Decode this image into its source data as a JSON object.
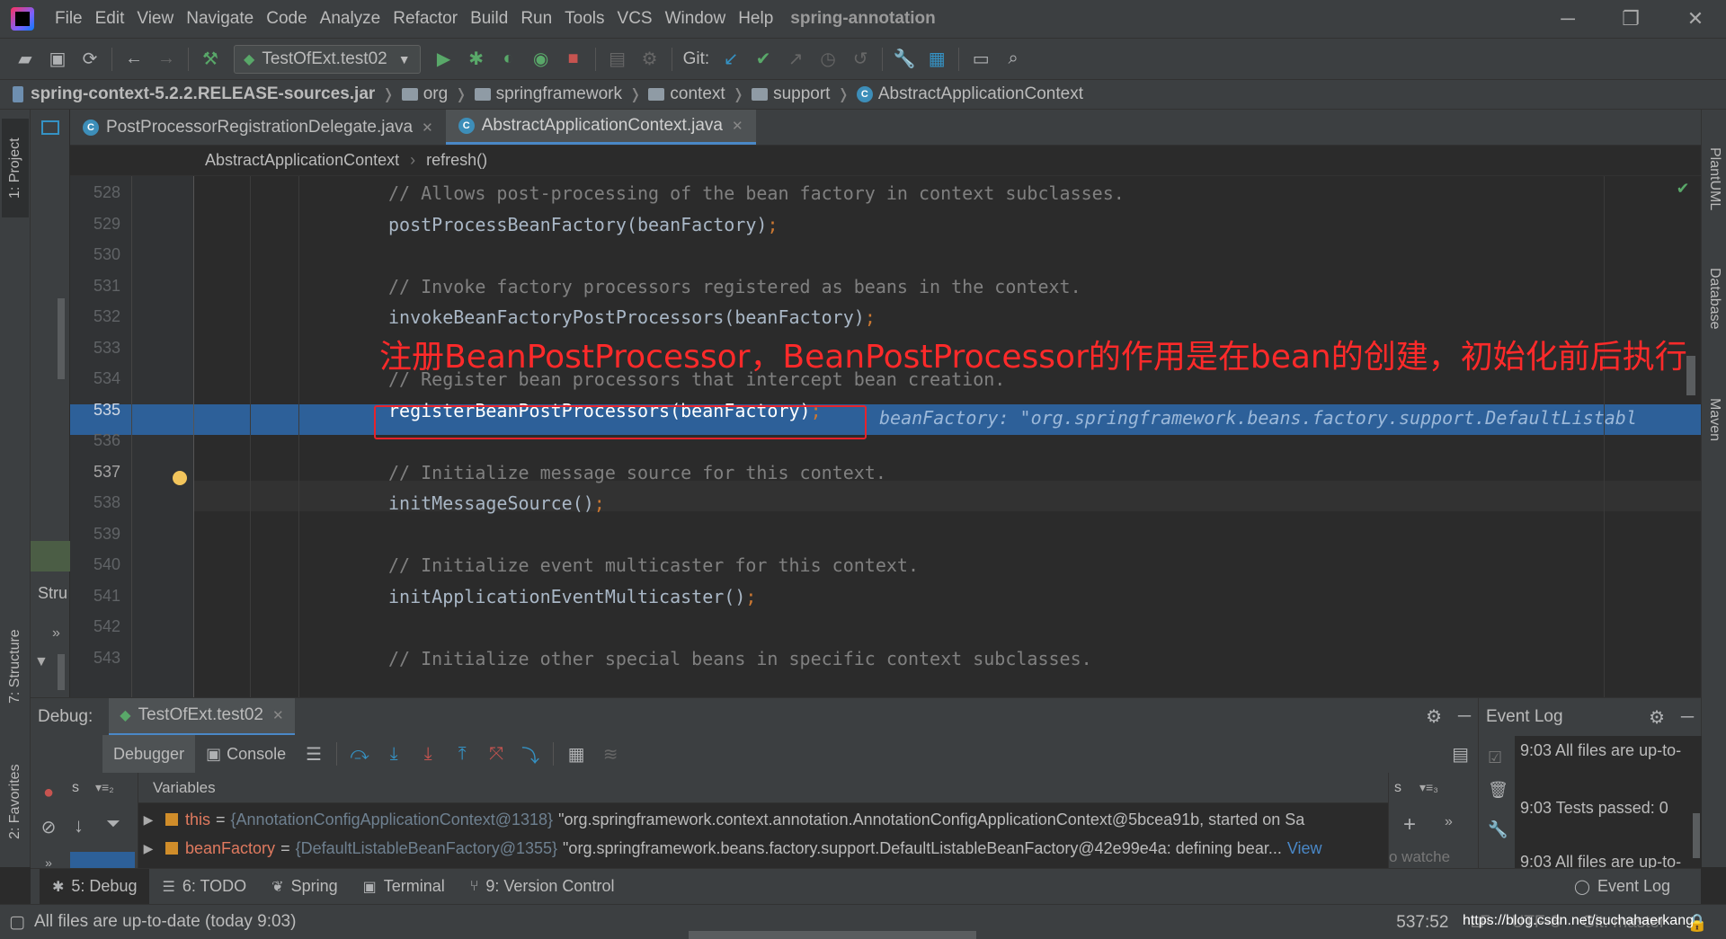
{
  "menubar": {
    "items": [
      "File",
      "Edit",
      "View",
      "Navigate",
      "Code",
      "Analyze",
      "Refactor",
      "Build",
      "Run",
      "Tools",
      "VCS",
      "Window",
      "Help"
    ],
    "project_title": "spring-annotation",
    "minimize": "─",
    "restore": "❐",
    "close": "✕"
  },
  "toolbar": {
    "run_config": "TestOfExt.test02",
    "git_label": "Git:"
  },
  "navbar": {
    "jar": "spring-context-5.2.2.RELEASE-sources.jar",
    "crumbs": [
      "org",
      "springframework",
      "context",
      "support"
    ],
    "class_name": "AbstractApplicationContext"
  },
  "editor": {
    "tabs": [
      {
        "label": "PostProcessorRegistrationDelegate.java",
        "active": false
      },
      {
        "label": "AbstractApplicationContext.java",
        "active": true
      }
    ],
    "breadcrumb": [
      "AbstractApplicationContext",
      "refresh()"
    ],
    "lines": [
      {
        "num": "528",
        "text": "// Allows post-processing of the bean factory in context subclasses.",
        "kind": "comment"
      },
      {
        "num": "529",
        "text": "postProcessBeanFactory(beanFactory)",
        "kind": "code"
      },
      {
        "num": "530",
        "text": "",
        "kind": "blank"
      },
      {
        "num": "531",
        "text": "// Invoke factory processors registered as beans in the context.",
        "kind": "comment"
      },
      {
        "num": "532",
        "text": "invokeBeanFactoryPostProcessors(beanFactory)",
        "kind": "code"
      },
      {
        "num": "533",
        "text": "",
        "kind": "blank"
      },
      {
        "num": "534",
        "text": "// Register bean processors that intercept bean creation.",
        "kind": "comment"
      },
      {
        "num": "535",
        "text": "registerBeanPostProcessors(beanFactory)",
        "kind": "code"
      },
      {
        "num": "536",
        "text": "",
        "kind": "blank"
      },
      {
        "num": "537",
        "text": "// Initialize message source for this context.",
        "kind": "comment"
      },
      {
        "num": "538",
        "text": "initMessageSource()",
        "kind": "code"
      },
      {
        "num": "539",
        "text": "",
        "kind": "blank"
      },
      {
        "num": "540",
        "text": "// Initialize event multicaster for this context.",
        "kind": "comment"
      },
      {
        "num": "541",
        "text": "initApplicationEventMulticaster()",
        "kind": "code"
      },
      {
        "num": "542",
        "text": "",
        "kind": "blank"
      },
      {
        "num": "543",
        "text": "// Initialize other special beans in specific context subclasses.",
        "kind": "comment"
      }
    ],
    "semicolon": ";",
    "inline_hint": "beanFactory: \"org.springframework.beans.factory.support.DefaultListabl",
    "annotation": "注册BeanPostProcessor，BeanPostProcessor的作用是在bean的创建，初始化前后执行"
  },
  "sidebars": {
    "project": "1: Project",
    "structure": "7: Structure",
    "favorites": "2: Favorites",
    "structure_short": "Stru",
    "plantuml": "PlantUML",
    "database": "Database",
    "maven": "Maven"
  },
  "debug": {
    "label": "Debug:",
    "session": "TestOfExt.test02",
    "debugger_tab": "Debugger",
    "console_tab": "Console",
    "variables_header": "Variables",
    "variables": [
      {
        "name": "this",
        "type": "{AnnotationConfigApplicationContext@1318}",
        "value": "\"org.springframework.context.annotation.AnnotationConfigApplicationContext@5bcea91b, started on Sa"
      },
      {
        "name": "beanFactory",
        "type": "{DefaultListableBeanFactory@1355}",
        "value": "\"org.springframework.beans.factory.support.DefaultListableBeanFactory@42e99e4a: defining bear...",
        "link": "View"
      }
    ],
    "watches_hint": "o watche"
  },
  "eventlog": {
    "title": "Event Log",
    "entries": [
      "9:03 All files are up-to-",
      "9:03 Tests passed: 0",
      "9:03 All files are up-to-"
    ]
  },
  "toolwindows": [
    {
      "label": "5: Debug",
      "icon": "bug-icon",
      "active": true
    },
    {
      "label": "6: TODO",
      "icon": "list-icon",
      "active": false
    },
    {
      "label": "Spring",
      "icon": "leaf-icon",
      "active": false
    },
    {
      "label": "Terminal",
      "icon": "terminal-icon",
      "active": false
    },
    {
      "label": "9: Version Control",
      "icon": "vcs-icon",
      "active": false
    }
  ],
  "toolwindow_right": "Event Log",
  "statusbar": {
    "message": "All files are up-to-date (today 9:03)",
    "position": "537:52",
    "line_sep": "LF",
    "encoding": "UTF-8",
    "git_branch": "Git: master"
  },
  "watermark": "https://blog.csdn.net/suchahaerkang",
  "colors": {
    "accent": "#4a88c7",
    "highlight_line": "#2d6099",
    "annotation": "#ff2a2a",
    "run_green": "#59a869"
  }
}
